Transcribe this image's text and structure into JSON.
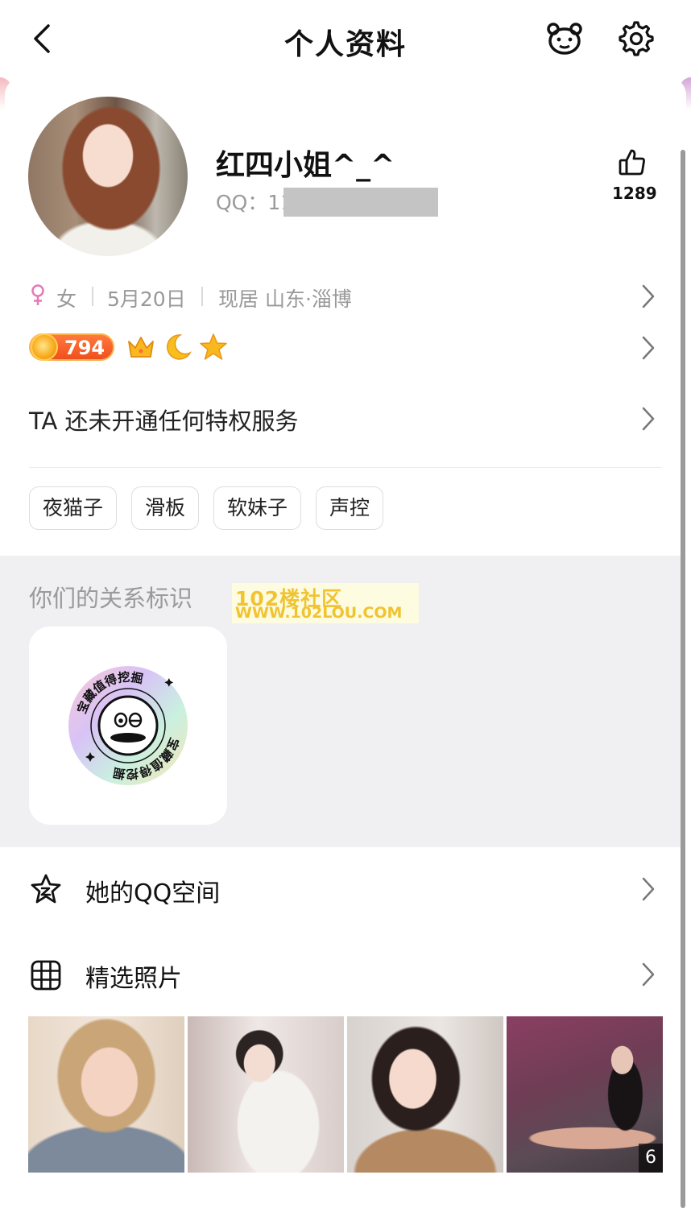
{
  "header": {
    "title": "个人资料",
    "back_icon": "chevron-left-icon",
    "bear_icon": "bear-face-icon",
    "settings_icon": "gear-icon"
  },
  "profile": {
    "nickname": "红四小姐^_^",
    "qq_label": "QQ：11",
    "likes": "1289",
    "gender": "女",
    "birthday": "5月20日",
    "location": "现居 山东·淄博"
  },
  "level": {
    "coin_value": "794",
    "icons": [
      "crown-icon",
      "moon-icon",
      "star-icon"
    ]
  },
  "privilege": {
    "text": "TA 还未开通任何特权服务"
  },
  "tags": [
    "夜猫子",
    "滑板",
    "软妹子",
    "声控"
  ],
  "relationship": {
    "title": "你们的关系标识",
    "badge_text_top": "宝藏值得挖掘",
    "badge_text_bottom": "宝藏值得挖掘"
  },
  "watermark": {
    "line1": "102楼社区",
    "line2": "WWW.102LOU.COM"
  },
  "menu": {
    "qzone": "她的QQ空间",
    "photos": "精选照片"
  },
  "photos": {
    "count": "6"
  },
  "colors": {
    "female": "#e779b5",
    "coin_badge": "#f0571f",
    "section_bg": "#f0f0f2",
    "watermark": "#f0c430"
  }
}
